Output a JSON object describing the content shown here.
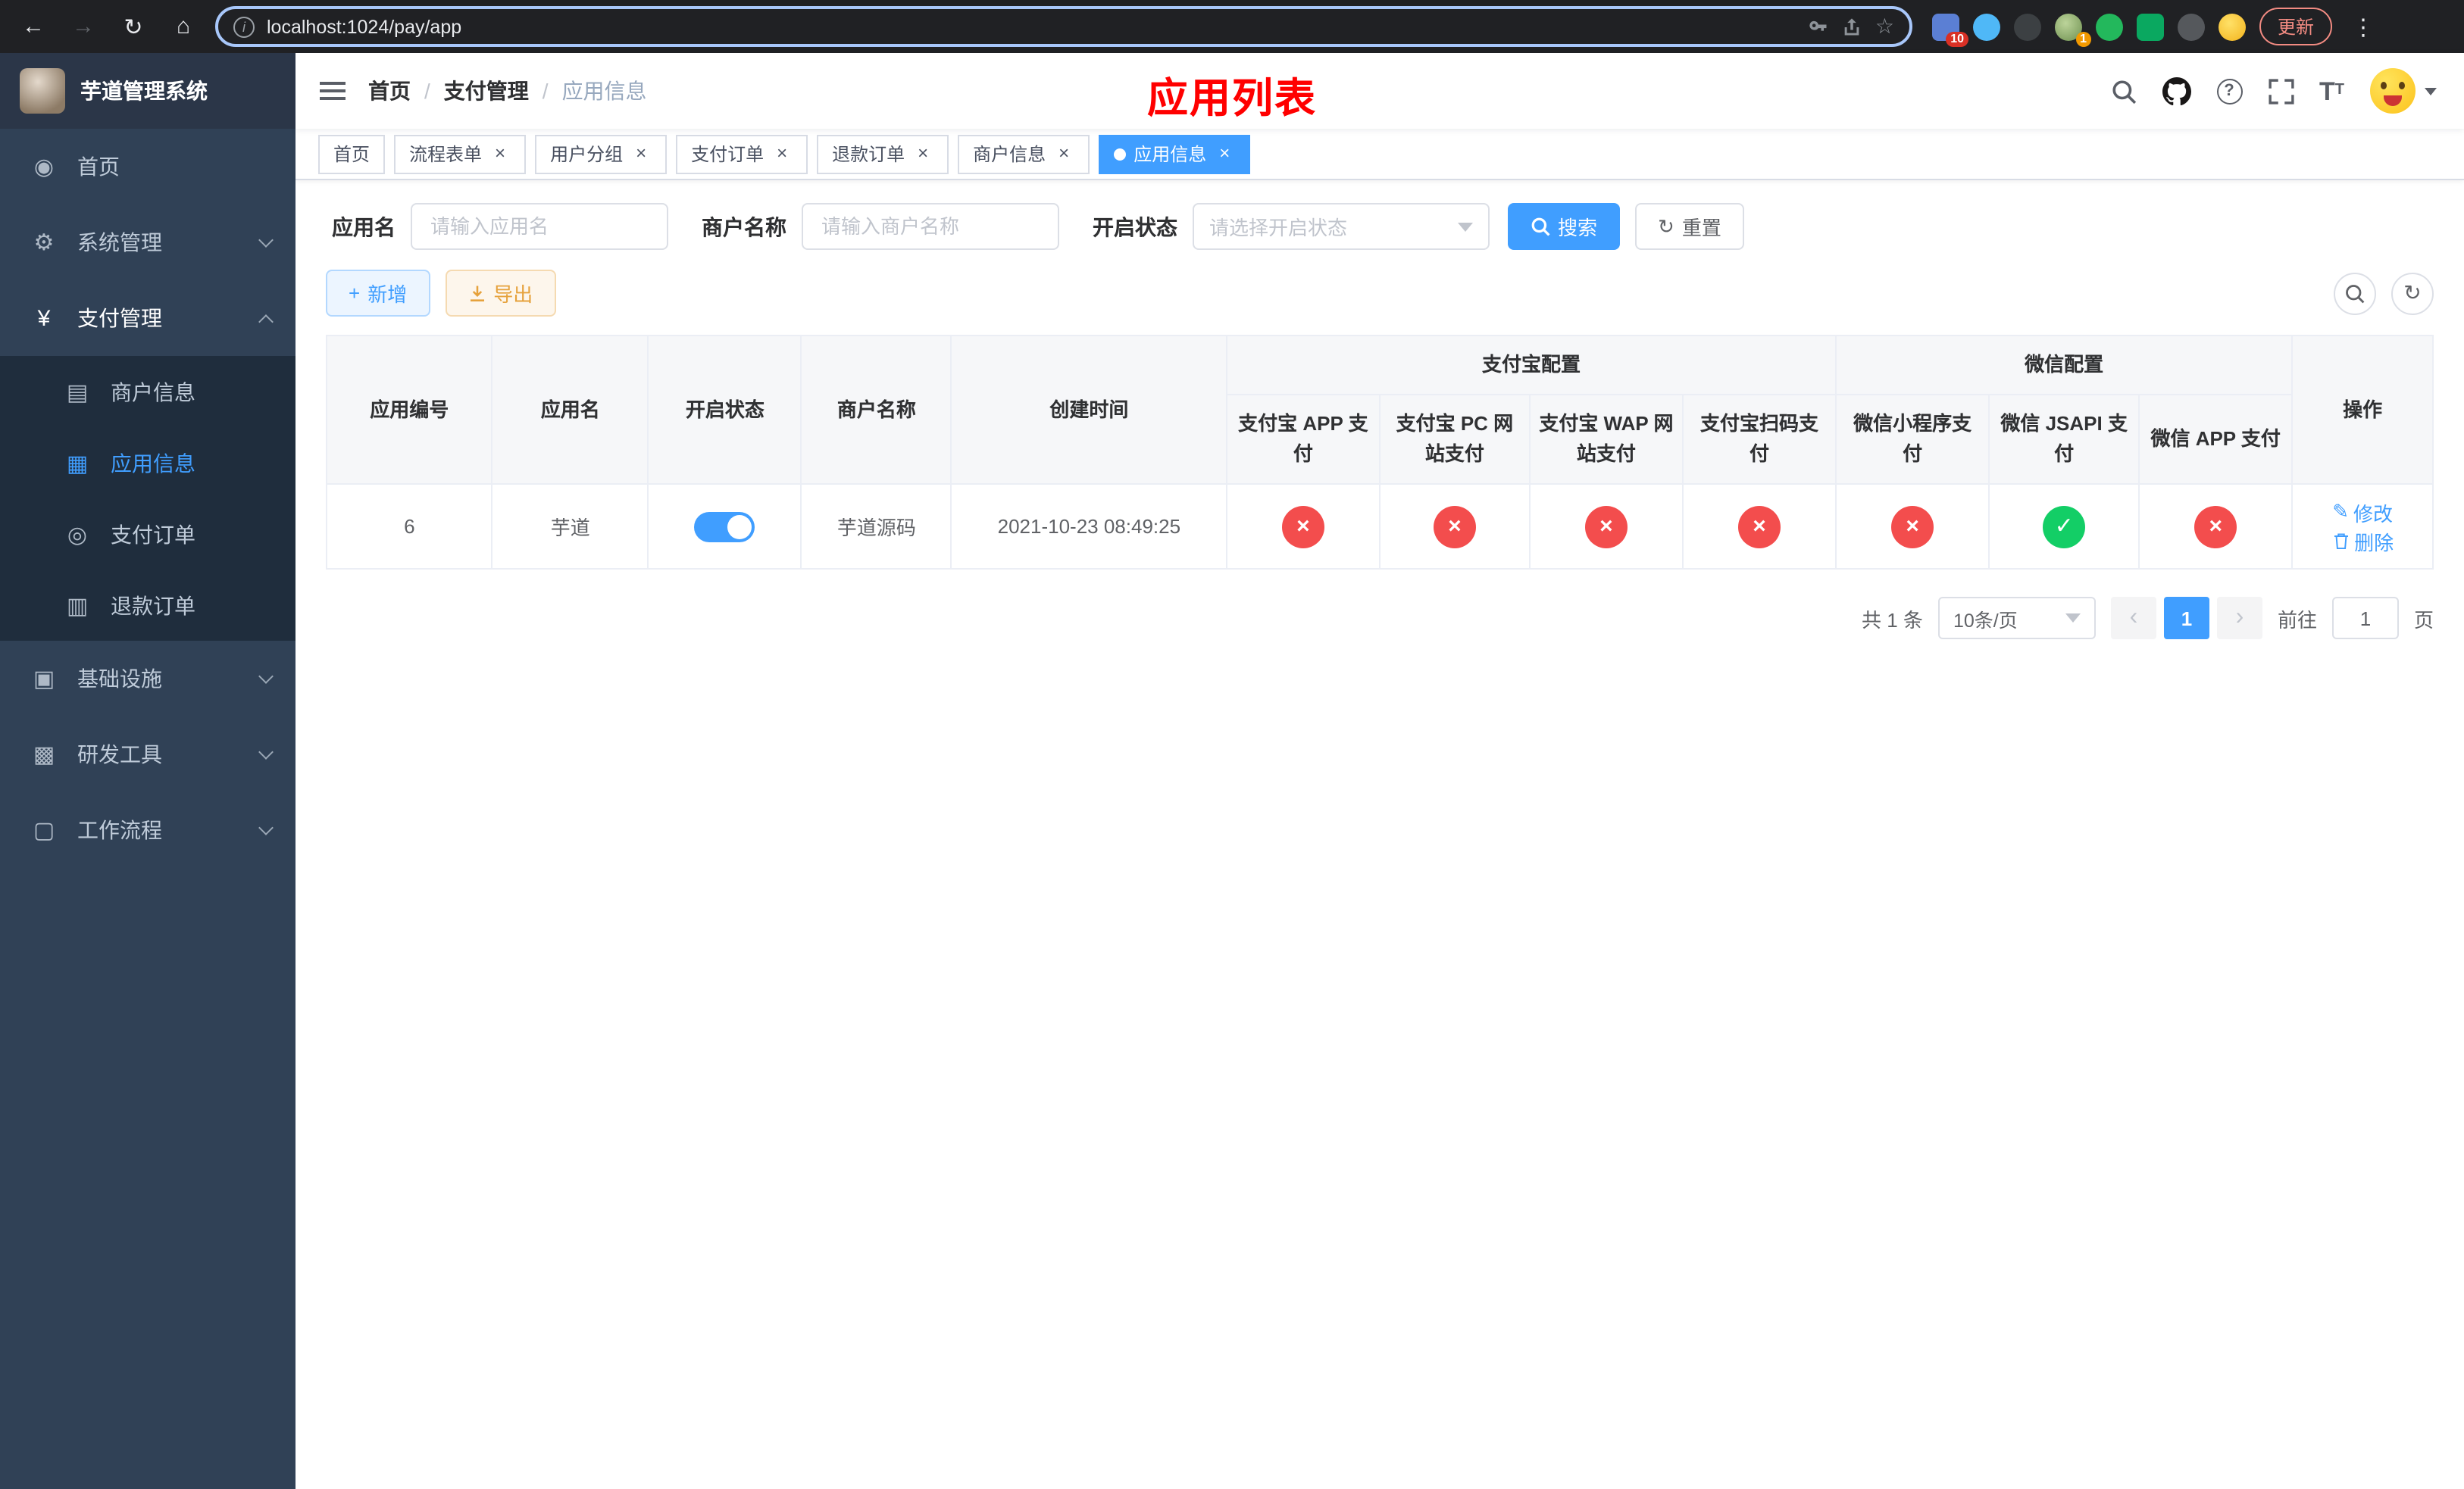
{
  "browser": {
    "url": "localhost:1024/pay/app",
    "update_label": "更新",
    "ext_badge_blue": "10",
    "ext_badge_avatar": "1"
  },
  "sidebar": {
    "logo_title": "芋道管理系统",
    "items": [
      {
        "label": "首页"
      },
      {
        "label": "系统管理"
      },
      {
        "label": "支付管理"
      },
      {
        "label": "商户信息"
      },
      {
        "label": "应用信息"
      },
      {
        "label": "支付订单"
      },
      {
        "label": "退款订单"
      },
      {
        "label": "基础设施"
      },
      {
        "label": "研发工具"
      },
      {
        "label": "工作流程"
      }
    ]
  },
  "header": {
    "breadcrumb_home": "首页",
    "breadcrumb_section": "支付管理",
    "breadcrumb_current": "应用信息",
    "page_title": "应用列表"
  },
  "tabs": [
    {
      "label": "首页"
    },
    {
      "label": "流程表单"
    },
    {
      "label": "用户分组"
    },
    {
      "label": "支付订单"
    },
    {
      "label": "退款订单"
    },
    {
      "label": "商户信息"
    },
    {
      "label": "应用信息"
    }
  ],
  "filters": {
    "app_name_label": "应用名",
    "app_name_placeholder": "请输入应用名",
    "merchant_label": "商户名称",
    "merchant_placeholder": "请输入商户名称",
    "status_label": "开启状态",
    "status_placeholder": "请选择开启状态",
    "search_label": "搜索",
    "reset_label": "重置"
  },
  "toolbar": {
    "add_label": "新增",
    "export_label": "导出"
  },
  "table": {
    "cols": {
      "id": "应用编号",
      "name": "应用名",
      "status": "开启状态",
      "merchant": "商户名称",
      "created": "创建时间",
      "alipay_group": "支付宝配置",
      "wechat_group": "微信配置",
      "alipay_app": "支付宝 APP 支付",
      "alipay_pc": "支付宝 PC 网站支付",
      "alipay_wap": "支付宝 WAP 网站支付",
      "alipay_qr": "支付宝扫码支付",
      "wx_mini": "微信小程序支付",
      "wx_jsapi": "微信 JSAPI 支付",
      "wx_app": "微信 APP 支付",
      "actions": "操作"
    },
    "row": {
      "id": "6",
      "name": "芋道",
      "enabled": true,
      "merchant": "芋道源码",
      "created": "2021-10-23 08:49:25",
      "configs": {
        "alipay_app": false,
        "alipay_pc": false,
        "alipay_wap": false,
        "alipay_qr": false,
        "wx_mini": false,
        "wx_jsapi": true,
        "wx_app": false
      },
      "edit_label": "修改",
      "delete_label": "删除"
    }
  },
  "pagination": {
    "total_text": "共 1 条",
    "page_size": "10条/页",
    "current_page": "1",
    "goto_label": "前往",
    "goto_value": "1",
    "goto_suffix": "页"
  },
  "icons": {
    "dashboard": "◉",
    "gear": "⚙",
    "yen": "¥",
    "merchant": "▤",
    "app": "▦",
    "order": "◎",
    "refund": "▥",
    "infra": "▣",
    "tools": "▩",
    "workflow": "▢",
    "check": "✓",
    "cross": "×",
    "plus": "+",
    "edit": "✎",
    "back": "←",
    "forward": "→",
    "reload": "↻",
    "home": "⌂",
    "star": "☆",
    "kebab": "⋮",
    "prev": "‹",
    "next": "›"
  },
  "colors": {
    "primary": "#409eff",
    "danger": "#f34d4d",
    "success": "#13ce66",
    "warning": "#e6a23c",
    "title_red": "#ff0000"
  }
}
